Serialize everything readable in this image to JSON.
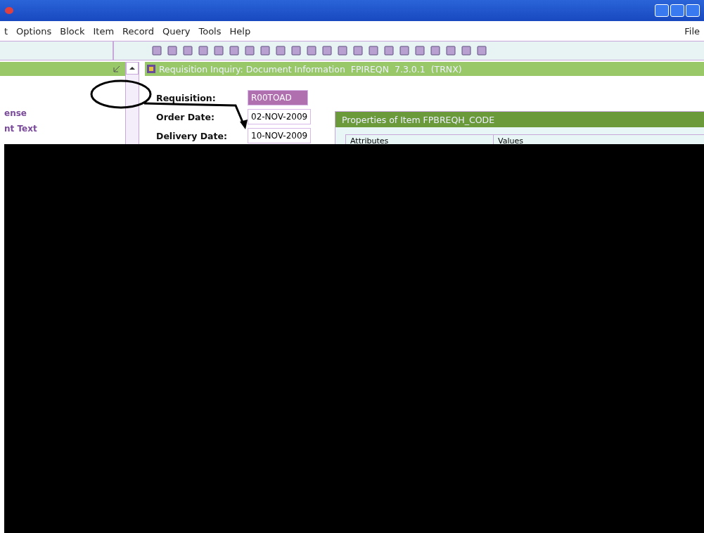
{
  "menu_bar": {
    "items": [
      "t",
      "Options",
      "Block",
      "Item",
      "Record",
      "Query",
      "Tools",
      "Help"
    ],
    "right_items": [
      "File"
    ]
  },
  "left_panel": {
    "items": [
      "ense",
      "nt Text"
    ]
  },
  "form": {
    "title": "Requisition Inquiry: Document Information  FPIREQN  7.3.0.1  (TRNX)",
    "fields": [
      {
        "label": "Requisition:",
        "value": "R00TOAD",
        "kind": "highlighted"
      },
      {
        "label": "Order Date:",
        "value": "02-NOV-2009",
        "kind": "plain"
      },
      {
        "label": "Delivery Date:",
        "value": "10-NOV-2009",
        "kind": "plain"
      }
    ]
  },
  "properties_dialog": {
    "title": "Properties of Item FPBREQH_CODE",
    "columns": [
      "Attributes",
      "Values"
    ]
  }
}
